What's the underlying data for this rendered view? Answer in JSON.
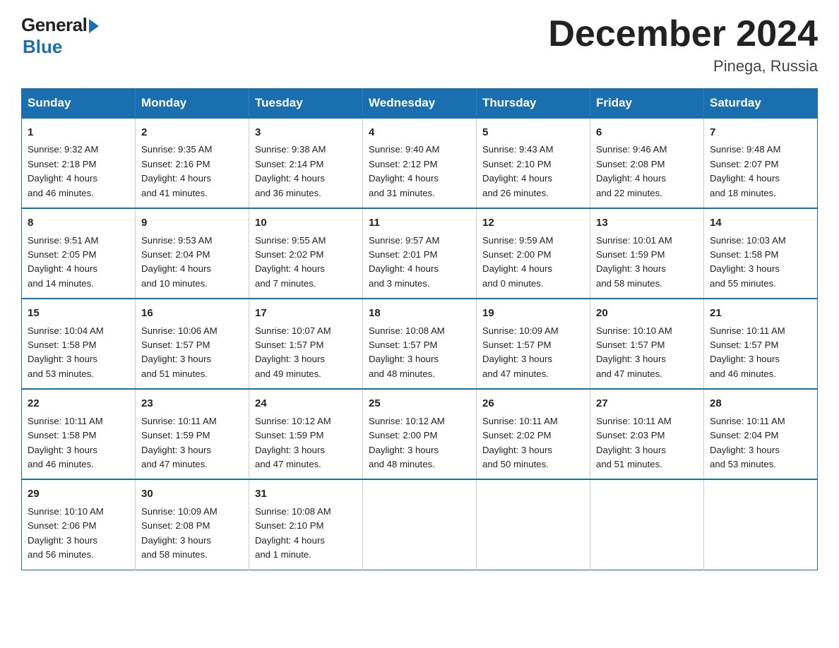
{
  "logo": {
    "general": "General",
    "blue": "Blue"
  },
  "title": "December 2024",
  "location": "Pinega, Russia",
  "days_of_week": [
    "Sunday",
    "Monday",
    "Tuesday",
    "Wednesday",
    "Thursday",
    "Friday",
    "Saturday"
  ],
  "weeks": [
    [
      {
        "day": "1",
        "sunrise": "9:32 AM",
        "sunset": "2:18 PM",
        "daylight": "4 hours and 46 minutes."
      },
      {
        "day": "2",
        "sunrise": "9:35 AM",
        "sunset": "2:16 PM",
        "daylight": "4 hours and 41 minutes."
      },
      {
        "day": "3",
        "sunrise": "9:38 AM",
        "sunset": "2:14 PM",
        "daylight": "4 hours and 36 minutes."
      },
      {
        "day": "4",
        "sunrise": "9:40 AM",
        "sunset": "2:12 PM",
        "daylight": "4 hours and 31 minutes."
      },
      {
        "day": "5",
        "sunrise": "9:43 AM",
        "sunset": "2:10 PM",
        "daylight": "4 hours and 26 minutes."
      },
      {
        "day": "6",
        "sunrise": "9:46 AM",
        "sunset": "2:08 PM",
        "daylight": "4 hours and 22 minutes."
      },
      {
        "day": "7",
        "sunrise": "9:48 AM",
        "sunset": "2:07 PM",
        "daylight": "4 hours and 18 minutes."
      }
    ],
    [
      {
        "day": "8",
        "sunrise": "9:51 AM",
        "sunset": "2:05 PM",
        "daylight": "4 hours and 14 minutes."
      },
      {
        "day": "9",
        "sunrise": "9:53 AM",
        "sunset": "2:04 PM",
        "daylight": "4 hours and 10 minutes."
      },
      {
        "day": "10",
        "sunrise": "9:55 AM",
        "sunset": "2:02 PM",
        "daylight": "4 hours and 7 minutes."
      },
      {
        "day": "11",
        "sunrise": "9:57 AM",
        "sunset": "2:01 PM",
        "daylight": "4 hours and 3 minutes."
      },
      {
        "day": "12",
        "sunrise": "9:59 AM",
        "sunset": "2:00 PM",
        "daylight": "4 hours and 0 minutes."
      },
      {
        "day": "13",
        "sunrise": "10:01 AM",
        "sunset": "1:59 PM",
        "daylight": "3 hours and 58 minutes."
      },
      {
        "day": "14",
        "sunrise": "10:03 AM",
        "sunset": "1:58 PM",
        "daylight": "3 hours and 55 minutes."
      }
    ],
    [
      {
        "day": "15",
        "sunrise": "10:04 AM",
        "sunset": "1:58 PM",
        "daylight": "3 hours and 53 minutes."
      },
      {
        "day": "16",
        "sunrise": "10:06 AM",
        "sunset": "1:57 PM",
        "daylight": "3 hours and 51 minutes."
      },
      {
        "day": "17",
        "sunrise": "10:07 AM",
        "sunset": "1:57 PM",
        "daylight": "3 hours and 49 minutes."
      },
      {
        "day": "18",
        "sunrise": "10:08 AM",
        "sunset": "1:57 PM",
        "daylight": "3 hours and 48 minutes."
      },
      {
        "day": "19",
        "sunrise": "10:09 AM",
        "sunset": "1:57 PM",
        "daylight": "3 hours and 47 minutes."
      },
      {
        "day": "20",
        "sunrise": "10:10 AM",
        "sunset": "1:57 PM",
        "daylight": "3 hours and 47 minutes."
      },
      {
        "day": "21",
        "sunrise": "10:11 AM",
        "sunset": "1:57 PM",
        "daylight": "3 hours and 46 minutes."
      }
    ],
    [
      {
        "day": "22",
        "sunrise": "10:11 AM",
        "sunset": "1:58 PM",
        "daylight": "3 hours and 46 minutes."
      },
      {
        "day": "23",
        "sunrise": "10:11 AM",
        "sunset": "1:59 PM",
        "daylight": "3 hours and 47 minutes."
      },
      {
        "day": "24",
        "sunrise": "10:12 AM",
        "sunset": "1:59 PM",
        "daylight": "3 hours and 47 minutes."
      },
      {
        "day": "25",
        "sunrise": "10:12 AM",
        "sunset": "2:00 PM",
        "daylight": "3 hours and 48 minutes."
      },
      {
        "day": "26",
        "sunrise": "10:11 AM",
        "sunset": "2:02 PM",
        "daylight": "3 hours and 50 minutes."
      },
      {
        "day": "27",
        "sunrise": "10:11 AM",
        "sunset": "2:03 PM",
        "daylight": "3 hours and 51 minutes."
      },
      {
        "day": "28",
        "sunrise": "10:11 AM",
        "sunset": "2:04 PM",
        "daylight": "3 hours and 53 minutes."
      }
    ],
    [
      {
        "day": "29",
        "sunrise": "10:10 AM",
        "sunset": "2:06 PM",
        "daylight": "3 hours and 56 minutes."
      },
      {
        "day": "30",
        "sunrise": "10:09 AM",
        "sunset": "2:08 PM",
        "daylight": "3 hours and 58 minutes."
      },
      {
        "day": "31",
        "sunrise": "10:08 AM",
        "sunset": "2:10 PM",
        "daylight": "4 hours and 1 minute."
      },
      null,
      null,
      null,
      null
    ]
  ],
  "labels": {
    "sunrise": "Sunrise:",
    "sunset": "Sunset:",
    "daylight": "Daylight:"
  }
}
